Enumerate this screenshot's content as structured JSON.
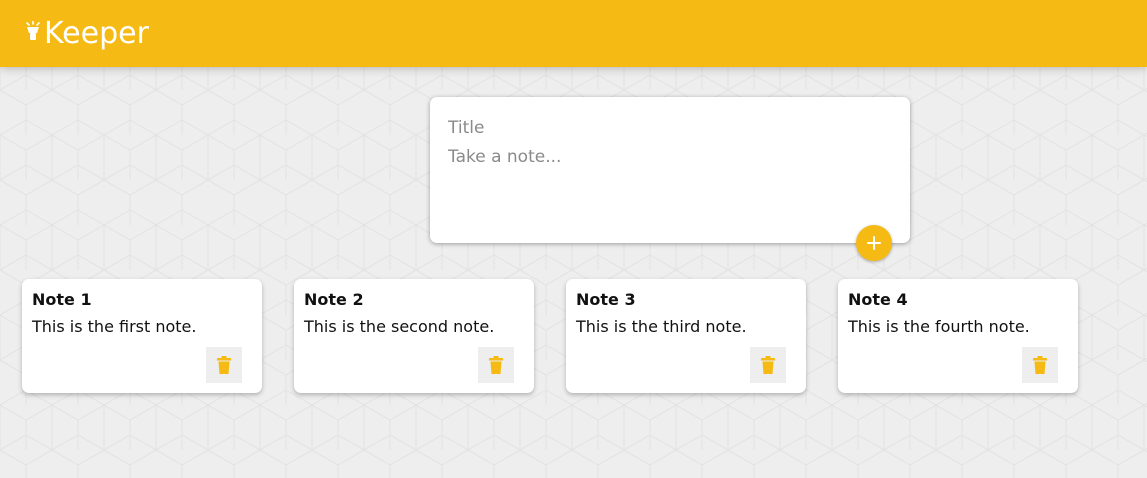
{
  "app": {
    "title": "Keeper",
    "logo_icon": "lightbulb-icon",
    "brand_color": "#f5ba13"
  },
  "create_note": {
    "title_placeholder": "Title",
    "content_placeholder": "Take a note...",
    "add_icon": "plus-icon"
  },
  "notes": [
    {
      "title": "Note 1",
      "content": "This is the first note.",
      "delete_icon": "trash-icon"
    },
    {
      "title": "Note 2",
      "content": "This is the second note.",
      "delete_icon": "trash-icon"
    },
    {
      "title": "Note 3",
      "content": "This is the third note.",
      "delete_icon": "trash-icon"
    },
    {
      "title": "Note 4",
      "content": "This is the fourth note.",
      "delete_icon": "trash-icon"
    }
  ]
}
